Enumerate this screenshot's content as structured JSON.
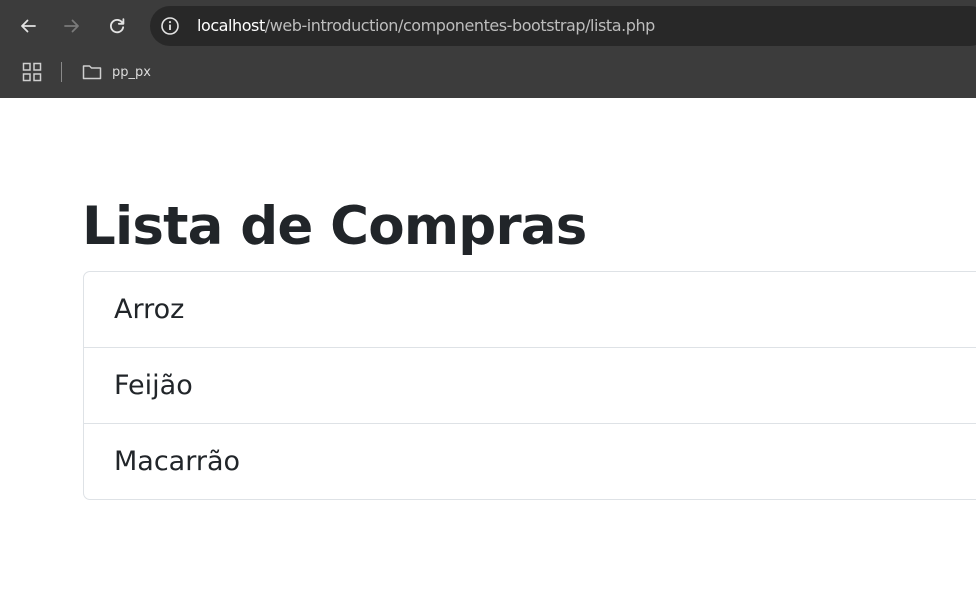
{
  "browser": {
    "address_bar": {
      "url_host": "localhost",
      "url_path": "/web-introduction/componentes-bootstrap/lista.php"
    },
    "bookmarks": [
      {
        "label": "pp_px",
        "icon": "folder-icon"
      }
    ],
    "icons": {
      "back": "arrow-left-icon",
      "forward": "arrow-right-icon",
      "reload": "reload-icon",
      "site_info": "info-icon",
      "apps": "apps-grid-icon"
    },
    "colors": {
      "chrome_bg": "#3c3c3c",
      "omnibox_bg": "#282828"
    }
  },
  "page": {
    "title": "Lista de Compras",
    "items": [
      "Arroz",
      "Feijão",
      "Macarrão"
    ],
    "colors": {
      "text": "#212529",
      "border": "#dee2e6"
    }
  }
}
